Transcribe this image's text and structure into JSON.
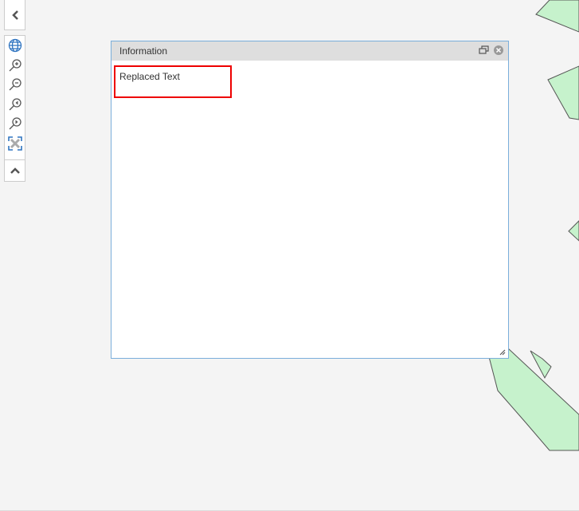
{
  "window": {
    "title": "Information",
    "content": "Replaced Text"
  },
  "colors": {
    "polygon": "#c6f2cc",
    "accent": "#2f74c0",
    "highlight": "#e00000"
  }
}
